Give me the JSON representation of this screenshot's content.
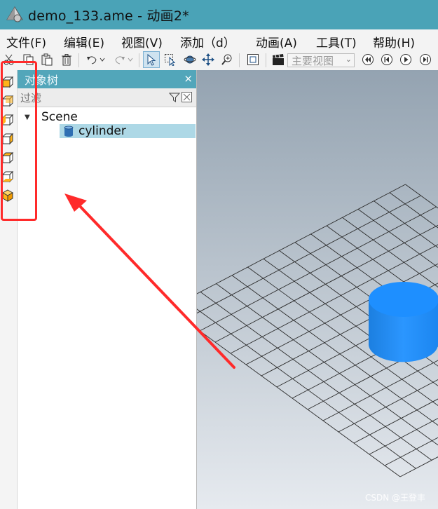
{
  "window": {
    "title": "demo_133.ame - 动画2*"
  },
  "menu": {
    "items": [
      {
        "label": "文件(F)"
      },
      {
        "label": "编辑(E)"
      },
      {
        "label": "视图(V)"
      },
      {
        "label": "添加（d）"
      },
      {
        "label": "动画(A)"
      },
      {
        "label": "工具(T)"
      },
      {
        "label": "帮助(H)"
      }
    ]
  },
  "toolbar": {
    "view_select_value": "主要视图",
    "icons": [
      "cut-icon",
      "copy-icon",
      "paste-icon",
      "delete-icon",
      "undo-icon",
      "redo-icon",
      "select-arrow-icon",
      "box-select-icon",
      "orbit-icon",
      "pan-icon",
      "zoom-icon",
      "fit-view-icon",
      "clapper-icon",
      "rewind-icon",
      "step-back-icon",
      "play-icon",
      "step-forward-icon"
    ]
  },
  "panel": {
    "title": "对象树",
    "close_label": "×",
    "filter_placeholder": "过滤"
  },
  "tree": {
    "root_label": "Scene",
    "child_label": "cylinder"
  },
  "viewport": {
    "watermark": "CSDN @王登丰",
    "cylinder_color": "#1e90ff"
  },
  "annotation": {
    "box_color": "#ff2a2a",
    "arrow_color": "#ff2a2a"
  },
  "colors": {
    "titlebar": "#4aa3b7",
    "panel_header": "#52a6ba",
    "selection": "#add8e6"
  }
}
